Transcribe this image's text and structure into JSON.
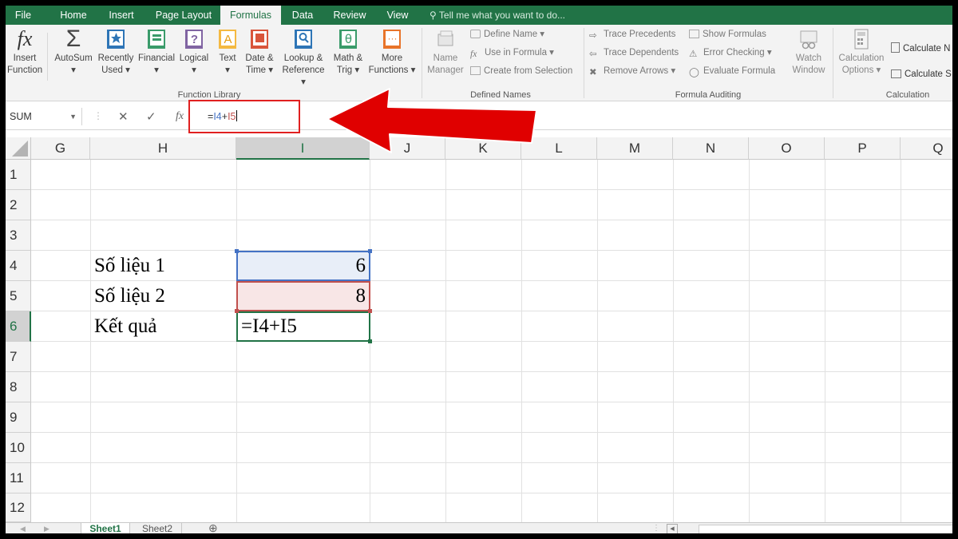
{
  "ribbon": {
    "tabs": [
      {
        "label": "File",
        "active": false
      },
      {
        "label": "Home",
        "active": false
      },
      {
        "label": "Insert",
        "active": false
      },
      {
        "label": "Page Layout",
        "active": false
      },
      {
        "label": "Formulas",
        "active": true
      },
      {
        "label": "Data",
        "active": false
      },
      {
        "label": "Review",
        "active": false
      },
      {
        "label": "View",
        "active": false
      }
    ],
    "tell_me": "Tell me what you want to do...",
    "function_library": {
      "label": "Function Library",
      "buttons": [
        {
          "line1": "Insert",
          "line2": "Function",
          "icon": "fx-icon"
        },
        {
          "line1": "AutoSum",
          "line2": "▾",
          "icon": "sigma-icon"
        },
        {
          "line1": "Recently",
          "line2": "Used ▾",
          "icon": "star-book-icon"
        },
        {
          "line1": "Financial",
          "line2": "▾",
          "icon": "financial-book-icon"
        },
        {
          "line1": "Logical",
          "line2": "▾",
          "icon": "logical-book-icon"
        },
        {
          "line1": "Text",
          "line2": "▾",
          "icon": "text-book-icon"
        },
        {
          "line1": "Date &",
          "line2": "Time ▾",
          "icon": "calendar-book-icon"
        },
        {
          "line1": "Lookup &",
          "line2": "Reference ▾",
          "icon": "lookup-book-icon"
        },
        {
          "line1": "Math &",
          "line2": "Trig ▾",
          "icon": "math-book-icon"
        },
        {
          "line1": "More",
          "line2": "Functions ▾",
          "icon": "more-book-icon"
        }
      ]
    },
    "defined_names": {
      "label": "Defined Names",
      "name_manager": {
        "line1": "Name",
        "line2": "Manager"
      },
      "items": [
        "Define Name ▾",
        "Use in Formula ▾",
        "Create from Selection"
      ]
    },
    "formula_auditing": {
      "label": "Formula Auditing",
      "left_items": [
        "Trace Precedents",
        "Trace Dependents",
        "Remove Arrows ▾"
      ],
      "right_items": [
        "Show Formulas",
        "Error Checking ▾",
        "Evaluate Formula"
      ],
      "watch_window": {
        "line1": "Watch",
        "line2": "Window"
      }
    },
    "calculation": {
      "label": "Calculation",
      "options": {
        "line1": "Calculation",
        "line2": "Options ▾"
      },
      "items": [
        "Calculate N",
        "Calculate S"
      ]
    }
  },
  "formula_bar": {
    "name_box": "SUM",
    "cancel": "✕",
    "enter": "✓",
    "fx": "fx",
    "formula_prefix": "=",
    "ref1": "I4",
    "plus": "+",
    "ref2": "I5"
  },
  "grid": {
    "columns": [
      {
        "label": "G",
        "selected": false
      },
      {
        "label": "H",
        "selected": false
      },
      {
        "label": "I",
        "selected": true
      },
      {
        "label": "J",
        "selected": false
      },
      {
        "label": "K",
        "selected": false
      },
      {
        "label": "L",
        "selected": false
      },
      {
        "label": "M",
        "selected": false
      },
      {
        "label": "N",
        "selected": false
      },
      {
        "label": "O",
        "selected": false
      },
      {
        "label": "P",
        "selected": false
      },
      {
        "label": "Q",
        "selected": false
      }
    ],
    "rows": [
      "1",
      "2",
      "3",
      "4",
      "5",
      "6",
      "7",
      "8",
      "9",
      "10",
      "11",
      "12"
    ],
    "selected_row": "6",
    "cells": {
      "h4": "Số liệu 1",
      "h5": "Số liệu 2",
      "h6": "Kết quả",
      "i4": "6",
      "i5": "8",
      "i6": "=I4+I5"
    },
    "ref_colors": {
      "i4": "#4472c4",
      "i5": "#c0504d",
      "active": "#217346"
    }
  },
  "sheets": {
    "tabs": [
      "Sheet1",
      "Sheet2"
    ],
    "active": "Sheet1",
    "add": "⊕"
  },
  "colors": {
    "excel_green": "#217346",
    "annotation_red": "#e02020"
  }
}
